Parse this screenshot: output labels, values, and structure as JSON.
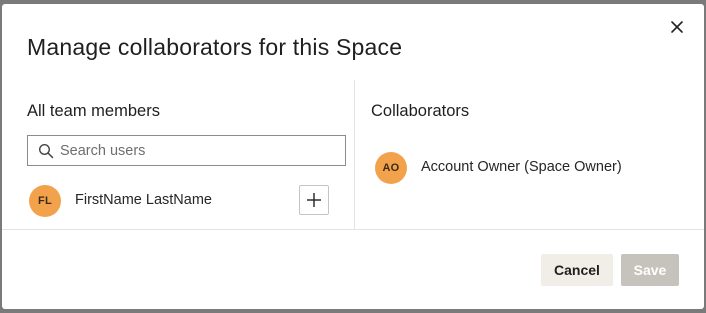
{
  "modal": {
    "title": "Manage collaborators for this Space"
  },
  "icons": {
    "close": "close-icon",
    "search": "search-icon",
    "add": "plus-icon"
  },
  "team_members": {
    "heading": "All team members",
    "search": {
      "placeholder": "Search users",
      "value": ""
    },
    "items": [
      {
        "initials": "FL",
        "name": "FirstName LastName"
      }
    ]
  },
  "collaborators": {
    "heading": "Collaborators",
    "items": [
      {
        "initials": "AO",
        "name": "Account Owner (Space Owner)"
      }
    ]
  },
  "footer": {
    "cancel_label": "Cancel",
    "save_label": "Save"
  },
  "colors": {
    "avatar": "#f3a24c",
    "cancel_bg": "#f1ede7",
    "save_disabled_bg": "#c6c2bc"
  }
}
